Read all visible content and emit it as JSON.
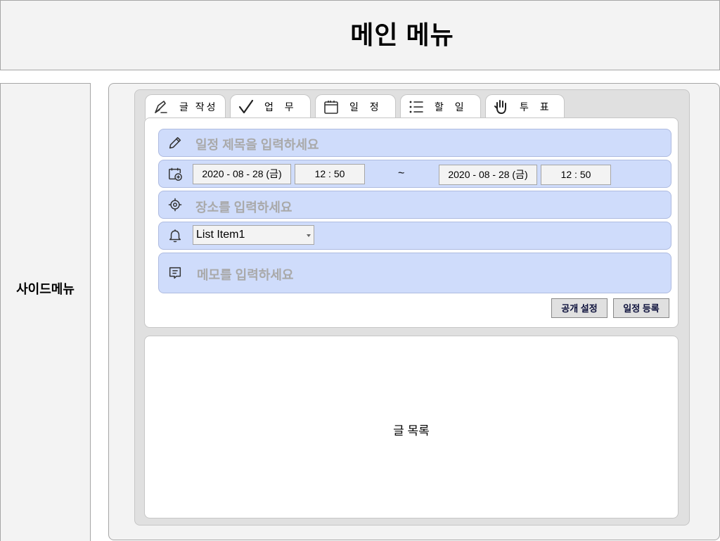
{
  "header": {
    "title": "메인 메뉴"
  },
  "sidebar": {
    "label": "사이드메뉴"
  },
  "tabs": [
    {
      "label": "글 작성",
      "icon": "pen-write-icon"
    },
    {
      "label": "업 무",
      "icon": "checkmark-icon"
    },
    {
      "label": "일 정",
      "icon": "calendar-icon"
    },
    {
      "label": "할 일",
      "icon": "list-icon"
    },
    {
      "label": "투 표",
      "icon": "hand-vote-icon"
    }
  ],
  "schedule_form": {
    "title_placeholder": "일정 제목을 입력하세요",
    "start_date": "2020 - 08 - 28 (금)",
    "start_time": "12 : 50",
    "range_separator": "~",
    "end_date": "2020 - 08 - 28 (금)",
    "end_time": "12 : 50",
    "location_placeholder": "장소를 입력하세요",
    "alarm_selected": "List Item1",
    "memo_placeholder": "메모를 입력하세요",
    "public_button": "공개 설정",
    "register_button": "일정 등록"
  },
  "post_list": {
    "label": "글 목록"
  },
  "colors": {
    "row_background": "#cfdcfb",
    "panel_gray": "#e0e0e0",
    "frame_gray": "#f3f3f3",
    "placeholder_text": "#a9a9a9"
  }
}
